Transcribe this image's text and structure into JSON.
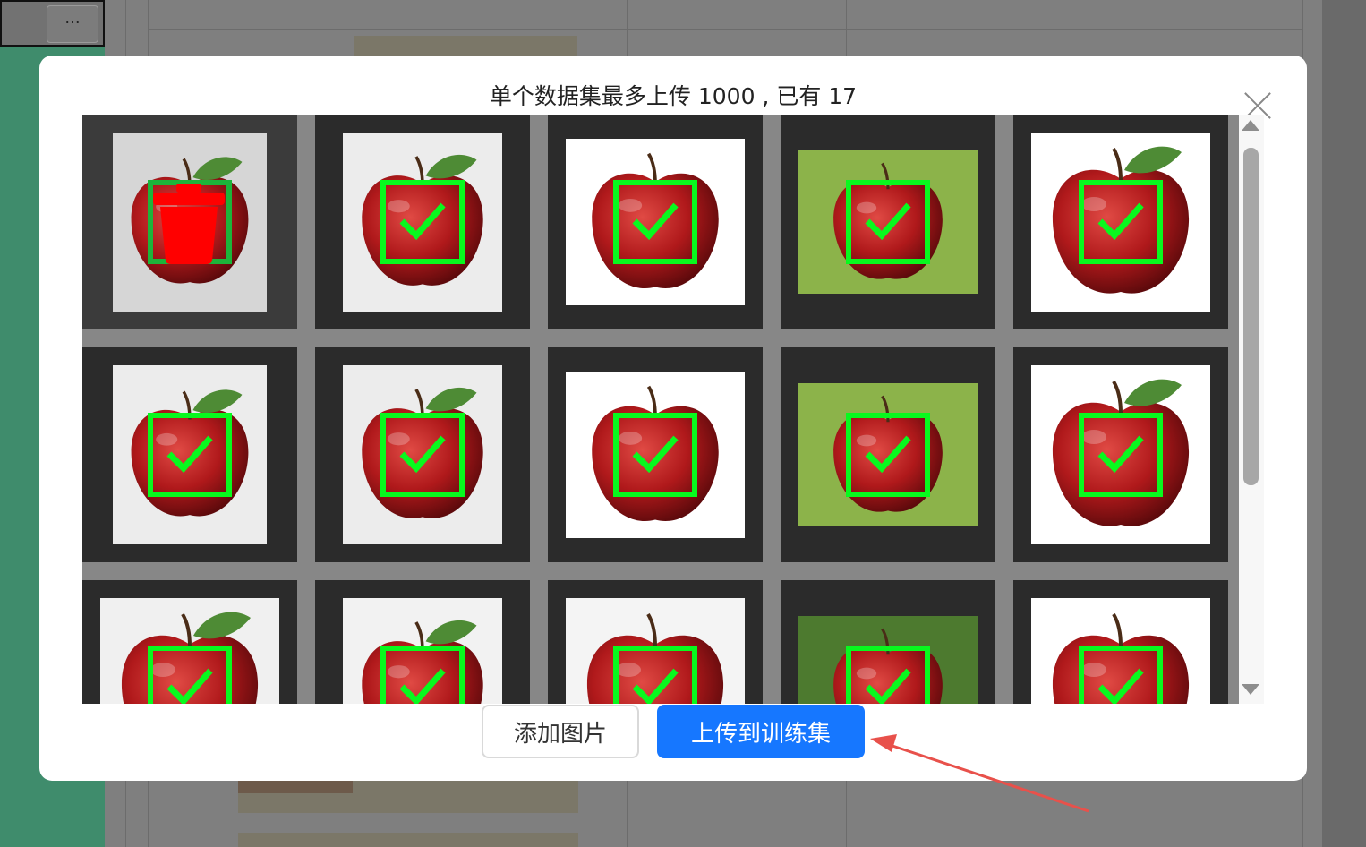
{
  "background": {
    "more_button": "···"
  },
  "modal": {
    "title": "单个数据集最多上传 1000 , 已有 17",
    "close_icon": "close-icon",
    "images": [
      {
        "bg": "#d6d6d6",
        "variant": "w-a",
        "state": "hover-delete",
        "leaf": true
      },
      {
        "bg": "#ececec",
        "variant": "w-b",
        "state": "selected",
        "leaf": true
      },
      {
        "bg": "#ffffff",
        "variant": "w-c",
        "state": "selected",
        "leaf": false
      },
      {
        "bg": "#8cb34a",
        "variant": "w-d",
        "state": "selected",
        "leaf": false
      },
      {
        "bg": "#ffffff",
        "variant": "w-e",
        "state": "selected",
        "leaf": true
      },
      {
        "bg": "#ececec",
        "variant": "w-a",
        "state": "selected",
        "leaf": true
      },
      {
        "bg": "#ececec",
        "variant": "w-b",
        "state": "selected",
        "leaf": true
      },
      {
        "bg": "#ffffff",
        "variant": "w-c",
        "state": "selected",
        "leaf": false
      },
      {
        "bg": "#8cb34a",
        "variant": "w-d",
        "state": "selected",
        "leaf": false
      },
      {
        "bg": "#ffffff",
        "variant": "w-e",
        "state": "selected",
        "leaf": true
      },
      {
        "bg": "#f0f0f0",
        "variant": "w-e",
        "state": "selected",
        "leaf": true
      },
      {
        "bg": "#f2f2f2",
        "variant": "w-b",
        "state": "selected",
        "leaf": true
      },
      {
        "bg": "#f4f4f4",
        "variant": "w-e",
        "state": "selected",
        "leaf": false
      },
      {
        "bg": "#4d7a2f",
        "variant": "w-d",
        "state": "selected",
        "leaf": false
      },
      {
        "bg": "#ffffff",
        "variant": "w-e",
        "state": "selected",
        "leaf": false
      }
    ],
    "buttons": {
      "add_label": "添加图片",
      "upload_label": "上传到训练集"
    },
    "colors": {
      "check": "#08f91e",
      "delete": "#ff0000",
      "primary": "#1677ff",
      "annotation_arrow": "#e8514b"
    }
  }
}
